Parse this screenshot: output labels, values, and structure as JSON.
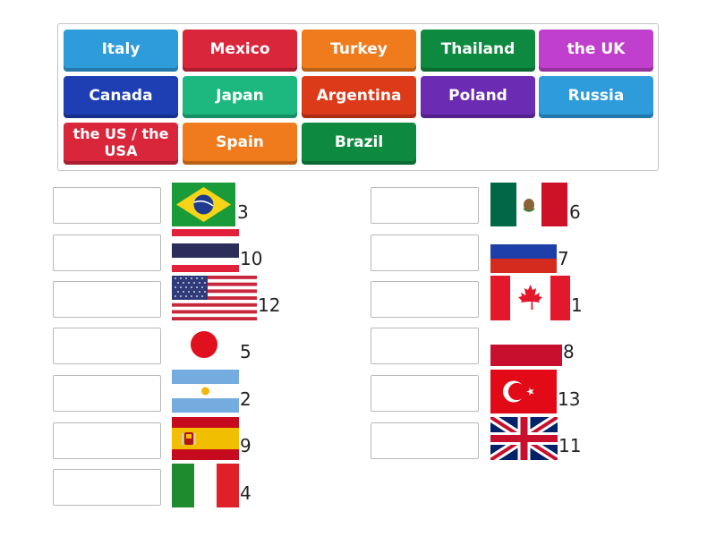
{
  "tiles": [
    {
      "label": "Italy",
      "color": "#2e9bdb"
    },
    {
      "label": "Mexico",
      "color": "#d9263b"
    },
    {
      "label": "Turkey",
      "color": "#f07b1c"
    },
    {
      "label": "Thailand",
      "color": "#0d8a3f"
    },
    {
      "label": "the UK",
      "color": "#c03fcc"
    },
    {
      "label": "Canada",
      "color": "#1d3fb3"
    },
    {
      "label": "Japan",
      "color": "#1cb87f"
    },
    {
      "label": "Argentina",
      "color": "#dd3a1a"
    },
    {
      "label": "Poland",
      "color": "#6b2bb3"
    },
    {
      "label": "Russia",
      "color": "#2e9bdb"
    },
    {
      "label": "the US / the USA",
      "color": "#d9263b"
    },
    {
      "label": "Spain",
      "color": "#f07b1c"
    },
    {
      "label": "Brazil",
      "color": "#0d8a3f"
    }
  ],
  "left_items": [
    {
      "flag": "brazil-flag",
      "number": "3"
    },
    {
      "flag": "thailand-flag",
      "number": "10"
    },
    {
      "flag": "usa-flag",
      "number": "12"
    },
    {
      "flag": "japan-flag",
      "number": "5"
    },
    {
      "flag": "argentina-flag",
      "number": "2"
    },
    {
      "flag": "spain-flag",
      "number": "9"
    },
    {
      "flag": "italy-flag",
      "number": "4"
    }
  ],
  "right_items": [
    {
      "flag": "mexico-flag",
      "number": "6"
    },
    {
      "flag": "russia-flag",
      "number": "7"
    },
    {
      "flag": "canada-flag",
      "number": "1"
    },
    {
      "flag": "poland-flag",
      "number": "8"
    },
    {
      "flag": "turkey-flag",
      "number": "13"
    },
    {
      "flag": "uk-flag",
      "number": "11"
    }
  ]
}
